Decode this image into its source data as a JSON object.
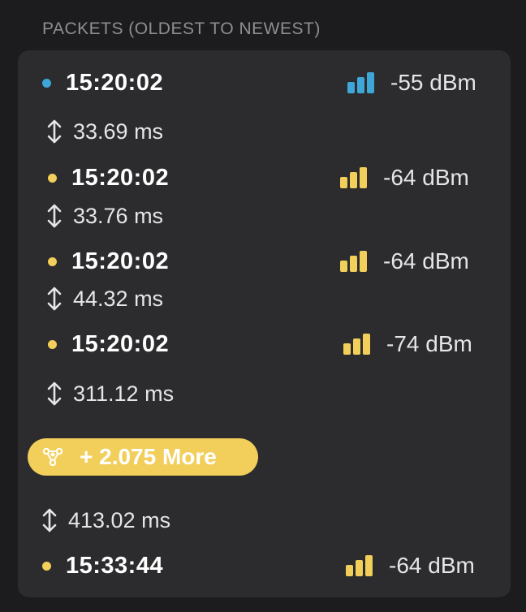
{
  "section": {
    "title": "PACKETS (OLDEST TO NEWEST)"
  },
  "colors": {
    "blue": "#3ea7d8",
    "yellow": "#f2cf5b"
  },
  "packets": [
    {
      "time": "15:20:02",
      "signal": "-55 dBm",
      "color": "blue",
      "latency": "33.69 ms"
    },
    {
      "time": "15:20:02",
      "signal": "-64 dBm",
      "color": "yellow",
      "latency": "33.76 ms"
    },
    {
      "time": "15:20:02",
      "signal": "-64 dBm",
      "color": "yellow",
      "latency": "44.32 ms"
    },
    {
      "time": "15:20:02",
      "signal": "-74 dBm",
      "color": "yellow",
      "latency": "311.12 ms"
    }
  ],
  "more": {
    "label": "+ 2.075 More",
    "icon": "network-hub-icon"
  },
  "last_packet": {
    "latency": "413.02 ms",
    "time": "15:33:44",
    "signal": "-64 dBm",
    "color": "yellow"
  }
}
